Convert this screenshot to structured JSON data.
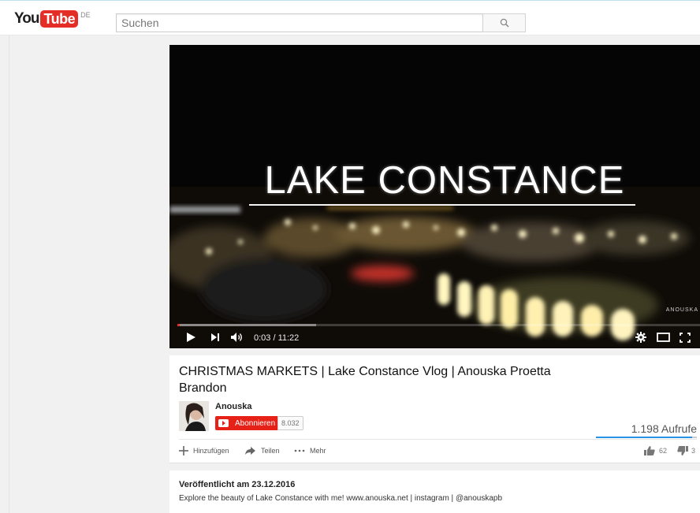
{
  "header": {
    "logo_you": "You",
    "logo_tube": "Tube",
    "logo_country": "DE",
    "search_placeholder": "Suchen"
  },
  "player": {
    "overlay_title": "LAKE CONSTANCE",
    "watermark": "ANOUSKA",
    "time_current": "0:03",
    "time_total": "11:22",
    "time_text": "0:03 / 11:22",
    "progress_played_fraction": 0.0045,
    "progress_loaded_fraction": 0.265
  },
  "video": {
    "title": "CHRISTMAS MARKETS | Lake Constance Vlog | Anouska Proetta Brandon",
    "channel_name": "Anouska",
    "subscribe_label": "Abonnieren",
    "subscriber_count": "8.032",
    "views": "1.198 Aufrufe",
    "like_ratio": 0.954,
    "actions": {
      "add": "Hinzufügen",
      "share": "Teilen",
      "more": "Mehr"
    },
    "likes": "62",
    "dislikes": "3"
  },
  "description": {
    "published": "Veröffentlicht am 23.12.2016",
    "text": "Explore the beauty of Lake Constance with me! www.anouska.net | instagram | @anouskapb"
  },
  "colors": {
    "brand_red": "#e52d27",
    "subscribe_red": "#e62117",
    "like_bar_blue": "#2793e6",
    "page_background": "#f1f1f1"
  },
  "icons": [
    "search-icon",
    "play-icon",
    "next-icon",
    "volume-icon",
    "settings-icon",
    "theater-icon",
    "fullscreen-icon",
    "add-icon",
    "share-icon",
    "more-icon",
    "like-icon",
    "dislike-icon"
  ]
}
